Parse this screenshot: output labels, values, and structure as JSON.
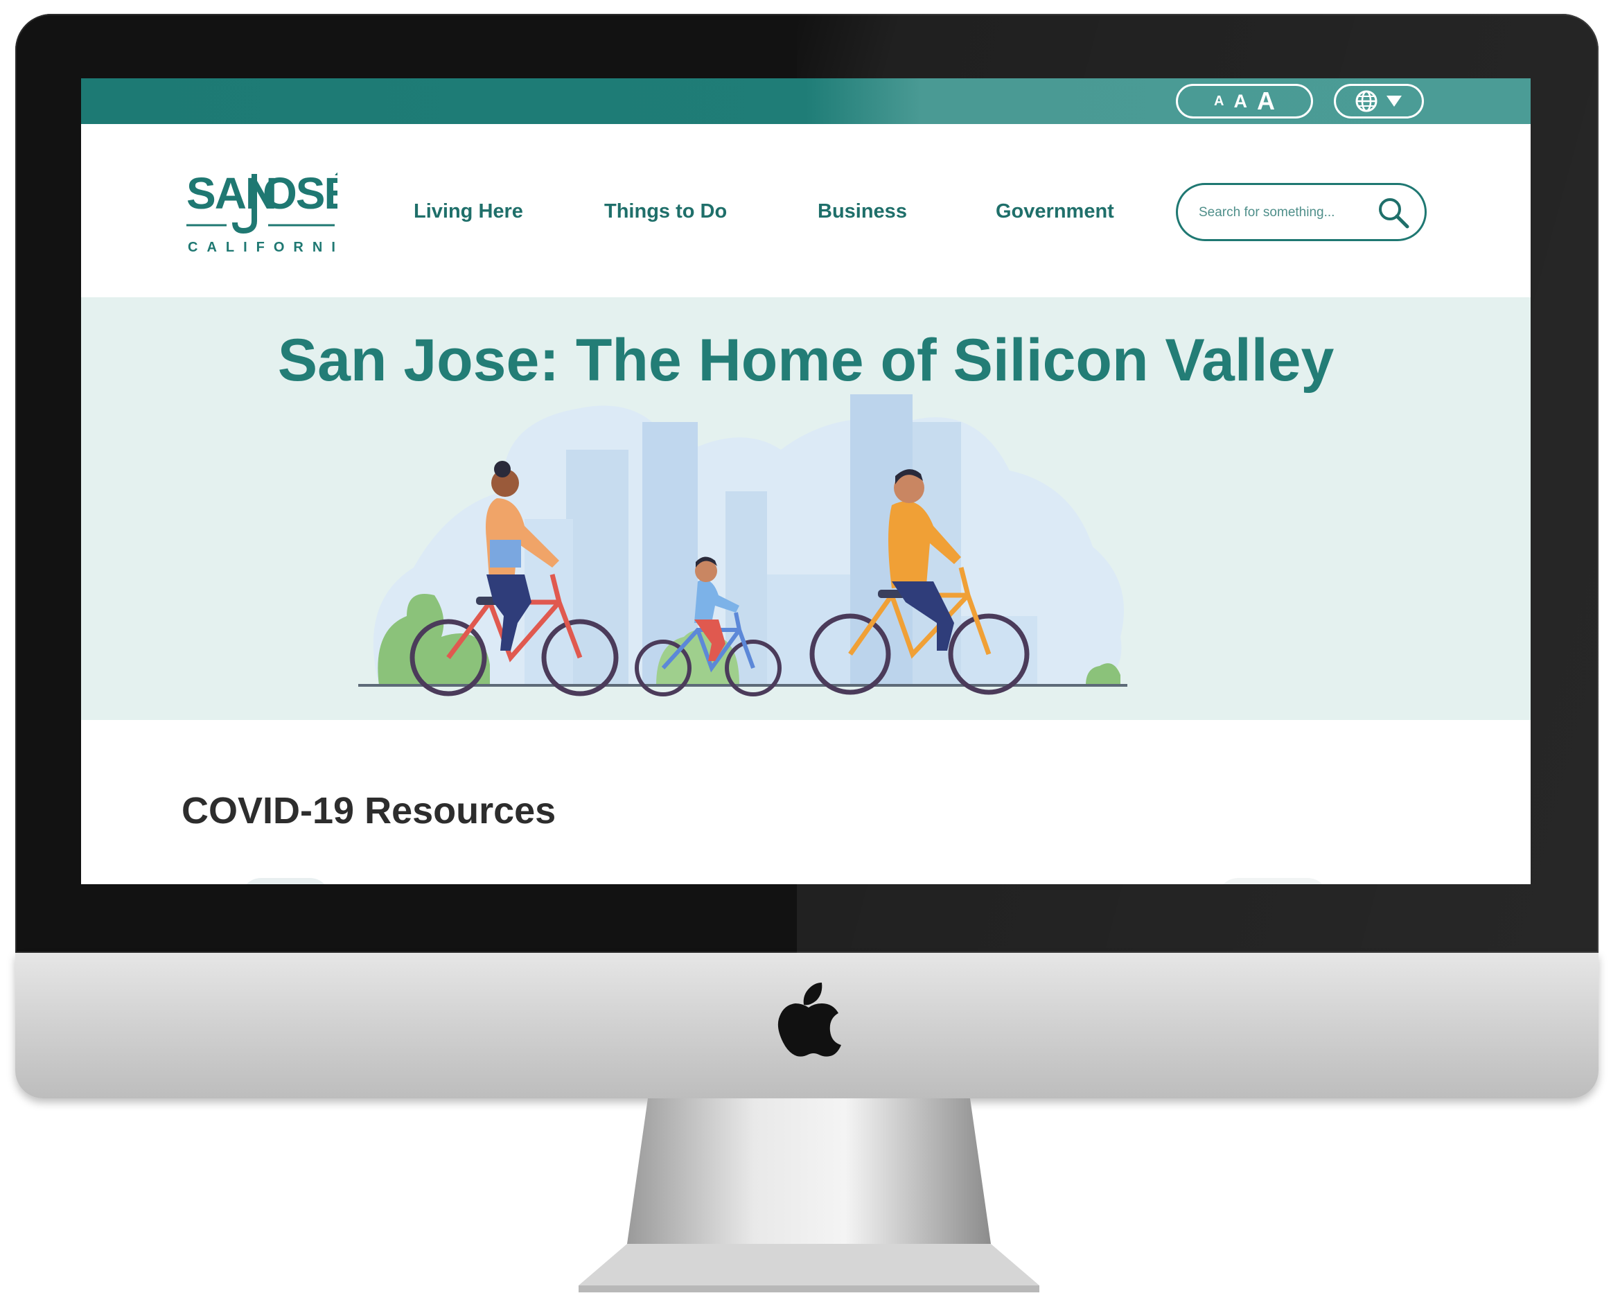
{
  "topbar": {
    "text_size": {
      "small": "A",
      "medium": "A",
      "large": "A"
    },
    "language_icon": "globe-icon",
    "language_caret_icon": "triangle-down-icon"
  },
  "logo": {
    "line1": "SANJOSÉ",
    "line2": "CALIFORNIA"
  },
  "nav": {
    "items": [
      {
        "label": "Living Here"
      },
      {
        "label": "Things to Do"
      },
      {
        "label": "Business"
      },
      {
        "label": "Government"
      }
    ]
  },
  "search": {
    "placeholder": "Search for something...",
    "icon": "magnifier-icon"
  },
  "hero": {
    "title": "San Jose: The Home of Silicon Valley"
  },
  "covid": {
    "title": "COVID-19 Resources"
  },
  "colors": {
    "brand_teal": "#1f7872",
    "hero_bg": "#e4f1ef",
    "heading_dark": "#2d2d2d"
  }
}
